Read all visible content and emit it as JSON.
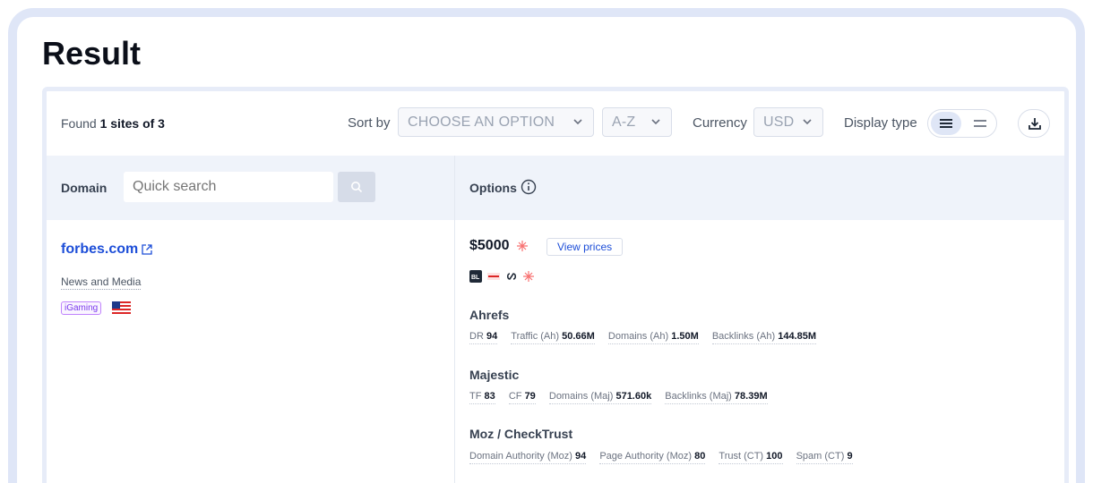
{
  "page_title": "Result",
  "toolbar": {
    "found_prefix": "Found",
    "found_bold": "1 sites of 3",
    "sort_label": "Sort by",
    "sort_value": "CHOOSE AN OPTION",
    "order_value": "A-Z",
    "currency_label": "Currency",
    "currency_value": "USD",
    "display_label": "Display type"
  },
  "table": {
    "domain_header": "Domain",
    "search_placeholder": "Quick search",
    "options_header": "Options"
  },
  "row": {
    "domain": "forbes.com",
    "category": "News and Media",
    "tag": "iGaming",
    "price": "$5000",
    "view_prices": "View prices",
    "ahrefs_title": "Ahrefs",
    "ahrefs": [
      {
        "label": "DR",
        "value": "94"
      },
      {
        "label": "Traffic (Ah)",
        "value": "50.66M"
      },
      {
        "label": "Domains (Ah)",
        "value": "1.50M"
      },
      {
        "label": "Backlinks (Ah)",
        "value": "144.85M"
      }
    ],
    "majestic_title": "Majestic",
    "majestic": [
      {
        "label": "TF",
        "value": "83"
      },
      {
        "label": "CF",
        "value": "79"
      },
      {
        "label": "Domains (Maj)",
        "value": "571.60k"
      },
      {
        "label": "Backlinks (Maj)",
        "value": "78.39M"
      }
    ],
    "moz_title": "Moz / CheckTrust",
    "moz": [
      {
        "label": "Domain Authority (Moz)",
        "value": "94"
      },
      {
        "label": "Page Authority (Moz)",
        "value": "80"
      },
      {
        "label": "Trust (CT)",
        "value": "100"
      },
      {
        "label": "Spam (CT)",
        "value": "9"
      }
    ]
  },
  "colors": {
    "accent": "#1d4ed8",
    "frame": "#dfe6f7",
    "tag": "#7c3aed"
  }
}
